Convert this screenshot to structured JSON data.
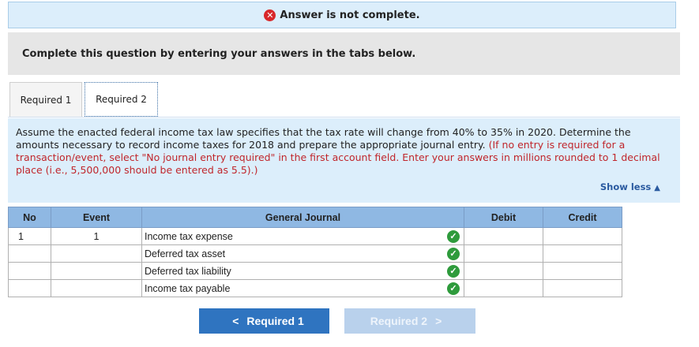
{
  "status": {
    "icon": "error-x-icon",
    "text": "Answer is not complete."
  },
  "instructions": {
    "text": "Complete this question by entering your answers in the tabs below."
  },
  "tabs": [
    {
      "label": "Required 1"
    },
    {
      "label": "Required 2"
    }
  ],
  "question": {
    "text": "Assume the enacted federal income tax law specifies that the tax rate will change from 40% to 35% in 2020. Determine the amounts necessary to record income taxes for 2018 and prepare the appropriate journal entry.",
    "note": "(If no entry is required for a transaction/event, select \"No journal entry required\" in the first account field. Enter your answers in millions rounded to 1 decimal place (i.e., 5,500,000 should be entered as 5.5).)",
    "show_less_label": "Show less"
  },
  "journal": {
    "headers": {
      "no": "No",
      "event": "Event",
      "general_journal": "General Journal",
      "debit": "Debit",
      "credit": "Credit"
    },
    "rows": [
      {
        "no": "1",
        "event": "1",
        "account": "Income tax expense",
        "debit": "",
        "credit": ""
      },
      {
        "no": "",
        "event": "",
        "account": "Deferred tax asset",
        "debit": "",
        "credit": ""
      },
      {
        "no": "",
        "event": "",
        "account": "Deferred tax liability",
        "debit": "",
        "credit": ""
      },
      {
        "no": "",
        "event": "",
        "account": "Income tax payable",
        "debit": "",
        "credit": ""
      }
    ]
  },
  "nav": {
    "prev_label": "Required 1",
    "next_label": "Required 2"
  },
  "colors": {
    "accent": "#2f74c0",
    "error": "#d8282b",
    "correct": "#2e9b3c",
    "note_red": "#c0262b"
  }
}
